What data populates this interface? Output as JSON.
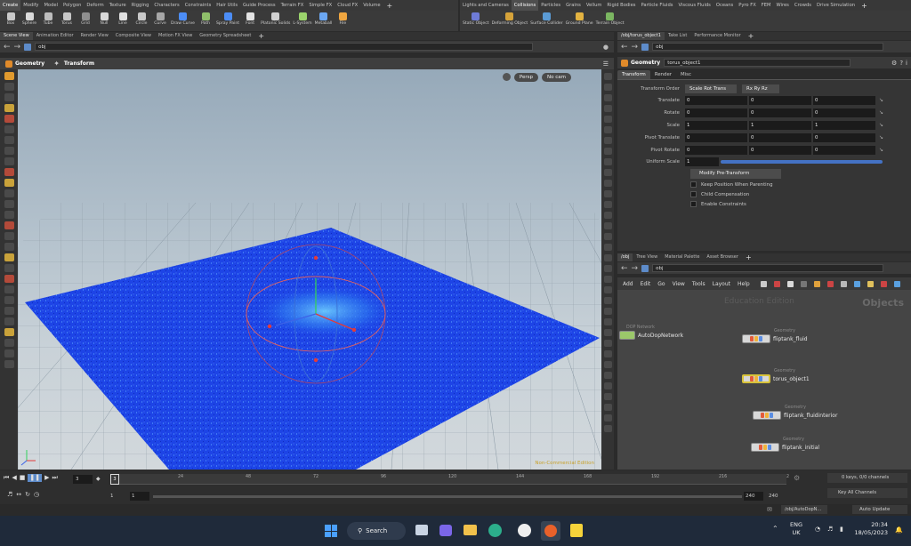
{
  "shelf_left": {
    "tabs": [
      "Create",
      "Modify",
      "Model",
      "Polygon",
      "Deform",
      "Texture",
      "Rigging",
      "Characters",
      "Constraints",
      "Hair Utils",
      "Guide Process",
      "Terrain FX",
      "Simple FX",
      "Cloud FX",
      "Volume"
    ],
    "active_tab": 0,
    "tools": [
      "Box",
      "Sphere",
      "Tube",
      "Torus",
      "Grid",
      "Null",
      "Line",
      "Circle",
      "Curve",
      "Draw Curve",
      "Path",
      "Spray Paint",
      "Font",
      "Platonic Solids",
      "L-System",
      "Metaball",
      "File"
    ]
  },
  "shelf_right": {
    "tabs": [
      "Lights and Cameras",
      "Collisions",
      "Particles",
      "Grains",
      "Vellum",
      "Rigid Bodies",
      "Particle Fluids",
      "Viscous Fluids",
      "Oceans",
      "Pyro FX",
      "FEM",
      "Wires",
      "Crowds",
      "Drive Simulation"
    ],
    "active_tab": 1,
    "tools": [
      "Static Object",
      "Deforming Object",
      "Surface Collider",
      "Ground Plane",
      "Terrain Object"
    ]
  },
  "left_pane_tabs": [
    "Scene View",
    "Animation Editor",
    "Render View",
    "Composite View",
    "Motion FX View",
    "Geometry Spreadsheet"
  ],
  "left_path": "obj",
  "viewport": {
    "context_label": "Geometry",
    "state_label": "Transform",
    "camera_persp": "Persp",
    "camera_cam": "No cam",
    "watermark": "Non-Commercial Edition"
  },
  "right_top_tabs": [
    "/obj/torus_object1",
    "Take List",
    "Performance Monitor"
  ],
  "right_top_path": "obj",
  "params": {
    "node_type": "Geometry",
    "node_name": "torus_object1",
    "tabs": [
      "Transform",
      "Render",
      "Misc"
    ],
    "active_tab": 0,
    "transform_order_label": "Transform Order",
    "transform_order_value": "Scale Rot Trans",
    "rot_order_value": "Rx Ry Rz",
    "rows": [
      {
        "label": "Translate",
        "values": [
          "0",
          "0",
          "0"
        ]
      },
      {
        "label": "Rotate",
        "values": [
          "0",
          "0",
          "0"
        ]
      },
      {
        "label": "Scale",
        "values": [
          "1",
          "1",
          "1"
        ]
      },
      {
        "label": "Pivot Translate",
        "values": [
          "0",
          "0",
          "0"
        ]
      },
      {
        "label": "Pivot Rotate",
        "values": [
          "0",
          "0",
          "0"
        ]
      }
    ],
    "uniform_scale_label": "Uniform Scale",
    "uniform_scale_value": "1",
    "modify_button": "Modify Pre-Transform",
    "checkboxes": [
      "Keep Position When Parenting",
      "Child Compensation",
      "Enable Constraints"
    ]
  },
  "network_tabs": [
    "/obj",
    "Tree View",
    "Material Palette",
    "Asset Browser"
  ],
  "network_path": "obj",
  "network_menu": [
    "Add",
    "Edit",
    "Go",
    "View",
    "Tools",
    "Layout",
    "Help"
  ],
  "network_watermark": "Education Edition",
  "network_context": "Objects",
  "nodes": [
    {
      "type": "DOP Network",
      "name": "AutoDopNetwork"
    },
    {
      "type": "Geometry",
      "name": "fliptank_fluid"
    },
    {
      "type": "Geometry",
      "name": "torus_object1"
    },
    {
      "type": "Geometry",
      "name": "fliptank_fluidinterior"
    },
    {
      "type": "Geometry",
      "name": "fliptank_initial"
    }
  ],
  "timeline": {
    "current_frame": "3",
    "frame_marker": "3",
    "ticks": [
      "24",
      "48",
      "72",
      "96",
      "120",
      "144",
      "168",
      "192",
      "216",
      "2"
    ],
    "start_a": "1",
    "start_b": "1",
    "end_a": "240",
    "end_b": "240",
    "keys_label": "0 keys, 0/0 channels",
    "key_all": "Key All Channels",
    "status_path": "/obj/AutoDopN...",
    "auto_update": "Auto Update"
  },
  "taskbar": {
    "search": "Search",
    "lang_top": "ENG",
    "lang_bottom": "UK",
    "time": "20:34",
    "date": "18/05/2023"
  }
}
